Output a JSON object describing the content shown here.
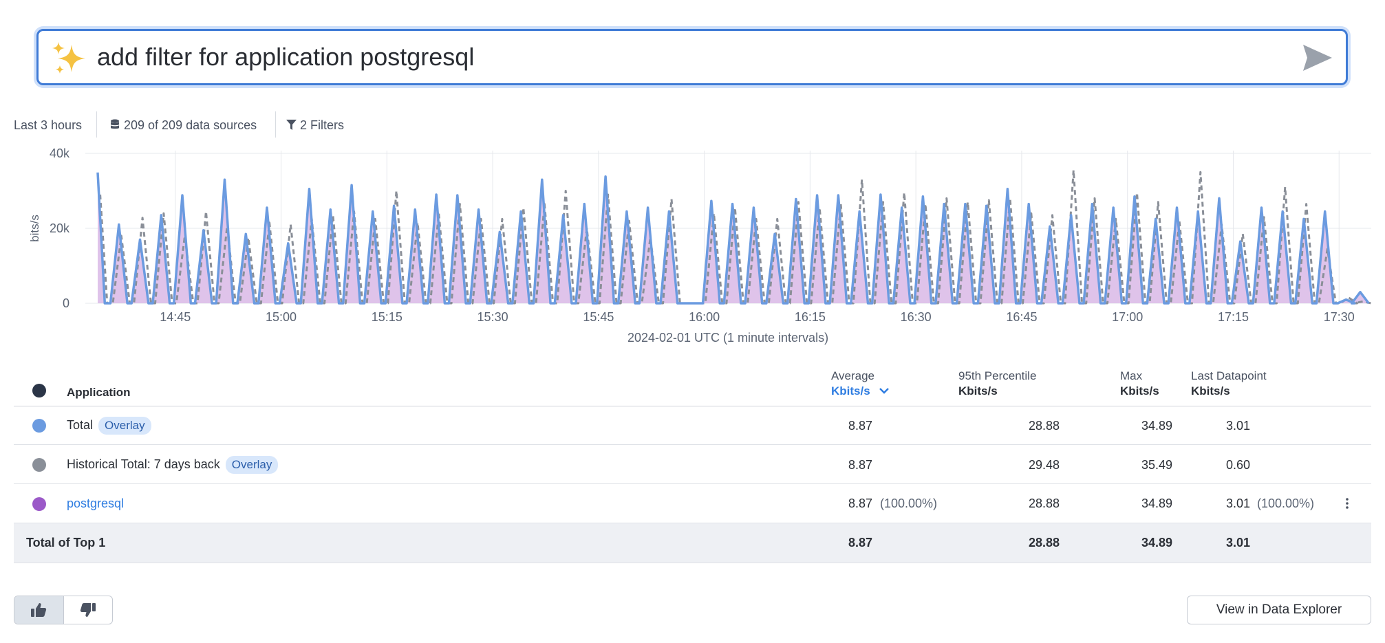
{
  "query": {
    "text": "add filter for application postgresql"
  },
  "toolbar": {
    "time_range": "Last 3 hours",
    "data_sources": "209 of 209 data sources",
    "filters": "2 Filters"
  },
  "chart_data": {
    "type": "area",
    "ylabel": "bits/s",
    "xlabel": "2024-02-01 UTC (1 minute intervals)",
    "y_ticks": [
      "0",
      "20k",
      "40k"
    ],
    "ylim": [
      0,
      40000
    ],
    "x_ticks": [
      "14:45",
      "15:00",
      "15:15",
      "15:30",
      "15:45",
      "16:00",
      "16:15",
      "16:30",
      "16:45",
      "17:00",
      "17:15",
      "17:30"
    ],
    "x_range": [
      "14:34",
      "17:33"
    ],
    "grid": true,
    "legend": "none",
    "series": [
      {
        "name": "Total",
        "style": "line",
        "color": "#6b9be0",
        "peaks": [
          {
            "t": "14:34",
            "v": 34900
          },
          {
            "t": "14:37",
            "v": 21000
          },
          {
            "t": "14:40",
            "v": 17000
          },
          {
            "t": "14:43",
            "v": 23500
          },
          {
            "t": "14:46",
            "v": 28800
          },
          {
            "t": "14:49",
            "v": 19500
          },
          {
            "t": "14:52",
            "v": 33000
          },
          {
            "t": "14:55",
            "v": 18500
          },
          {
            "t": "14:58",
            "v": 25500
          },
          {
            "t": "15:01",
            "v": 16000
          },
          {
            "t": "15:04",
            "v": 30500
          },
          {
            "t": "15:07",
            "v": 25000
          },
          {
            "t": "15:10",
            "v": 31500
          },
          {
            "t": "15:13",
            "v": 24500
          },
          {
            "t": "15:16",
            "v": 26000
          },
          {
            "t": "15:19",
            "v": 25000
          },
          {
            "t": "15:22",
            "v": 29000
          },
          {
            "t": "15:25",
            "v": 28800
          },
          {
            "t": "15:28",
            "v": 25000
          },
          {
            "t": "15:31",
            "v": 19000
          },
          {
            "t": "15:34",
            "v": 24500
          },
          {
            "t": "15:37",
            "v": 33000
          },
          {
            "t": "15:40",
            "v": 23500
          },
          {
            "t": "15:43",
            "v": 26500
          },
          {
            "t": "15:46",
            "v": 33800
          },
          {
            "t": "15:49",
            "v": 24500
          },
          {
            "t": "15:52",
            "v": 25500
          },
          {
            "t": "15:55",
            "v": 24500
          },
          {
            "t": "16:01",
            "v": 27300
          },
          {
            "t": "16:04",
            "v": 26500
          },
          {
            "t": "16:07",
            "v": 25500
          },
          {
            "t": "16:10",
            "v": 18500
          },
          {
            "t": "16:13",
            "v": 27800
          },
          {
            "t": "16:16",
            "v": 28800
          },
          {
            "t": "16:19",
            "v": 28800
          },
          {
            "t": "16:22",
            "v": 24500
          },
          {
            "t": "16:25",
            "v": 29000
          },
          {
            "t": "16:28",
            "v": 25500
          },
          {
            "t": "16:31",
            "v": 28500
          },
          {
            "t": "16:34",
            "v": 26500
          },
          {
            "t": "16:37",
            "v": 26500
          },
          {
            "t": "16:40",
            "v": 26000
          },
          {
            "t": "16:43",
            "v": 30500
          },
          {
            "t": "16:46",
            "v": 26500
          },
          {
            "t": "16:49",
            "v": 20500
          },
          {
            "t": "16:52",
            "v": 23500
          },
          {
            "t": "16:55",
            "v": 26500
          },
          {
            "t": "16:58",
            "v": 25500
          },
          {
            "t": "17:01",
            "v": 28500
          },
          {
            "t": "17:04",
            "v": 22500
          },
          {
            "t": "17:07",
            "v": 25500
          },
          {
            "t": "17:10",
            "v": 24500
          },
          {
            "t": "17:13",
            "v": 28000
          },
          {
            "t": "17:16",
            "v": 16500
          },
          {
            "t": "17:19",
            "v": 25500
          },
          {
            "t": "17:22",
            "v": 24500
          },
          {
            "t": "17:25",
            "v": 22500
          },
          {
            "t": "17:28",
            "v": 24500
          },
          {
            "t": "17:31",
            "v": 1000
          },
          {
            "t": "17:33",
            "v": 3000
          }
        ]
      },
      {
        "name": "Historical Total: 7 days back",
        "style": "dashed",
        "color": "#8a8f98",
        "peaks": [
          {
            "t": "14:34",
            "v": 29000
          },
          {
            "t": "14:37",
            "v": 18000
          },
          {
            "t": "14:40",
            "v": 22800
          },
          {
            "t": "14:43",
            "v": 24000
          },
          {
            "t": "14:46",
            "v": 18000
          },
          {
            "t": "14:49",
            "v": 24500
          },
          {
            "t": "14:52",
            "v": 20500
          },
          {
            "t": "14:55",
            "v": 17500
          },
          {
            "t": "14:58",
            "v": 21500
          },
          {
            "t": "15:01",
            "v": 21000
          },
          {
            "t": "15:04",
            "v": 22500
          },
          {
            "t": "15:07",
            "v": 23500
          },
          {
            "t": "15:10",
            "v": 24500
          },
          {
            "t": "15:13",
            "v": 22500
          },
          {
            "t": "15:16",
            "v": 30000
          },
          {
            "t": "15:19",
            "v": 21500
          },
          {
            "t": "15:22",
            "v": 24000
          },
          {
            "t": "15:25",
            "v": 26500
          },
          {
            "t": "15:28",
            "v": 22500
          },
          {
            "t": "15:31",
            "v": 22500
          },
          {
            "t": "15:34",
            "v": 25500
          },
          {
            "t": "15:37",
            "v": 26500
          },
          {
            "t": "15:40",
            "v": 30000
          },
          {
            "t": "15:43",
            "v": 20000
          },
          {
            "t": "15:46",
            "v": 29000
          },
          {
            "t": "15:49",
            "v": 22000
          },
          {
            "t": "15:52",
            "v": 17500
          },
          {
            "t": "15:55",
            "v": 27800
          },
          {
            "t": "16:01",
            "v": 24000
          },
          {
            "t": "16:04",
            "v": 25500
          },
          {
            "t": "16:07",
            "v": 22500
          },
          {
            "t": "16:10",
            "v": 22500
          },
          {
            "t": "16:13",
            "v": 27000
          },
          {
            "t": "16:16",
            "v": 25500
          },
          {
            "t": "16:19",
            "v": 26500
          },
          {
            "t": "16:22",
            "v": 33000
          },
          {
            "t": "16:25",
            "v": 27000
          },
          {
            "t": "16:28",
            "v": 29500
          },
          {
            "t": "16:31",
            "v": 26500
          },
          {
            "t": "16:34",
            "v": 28000
          },
          {
            "t": "16:37",
            "v": 27000
          },
          {
            "t": "16:40",
            "v": 27500
          },
          {
            "t": "16:43",
            "v": 28000
          },
          {
            "t": "16:46",
            "v": 24000
          },
          {
            "t": "16:49",
            "v": 23500
          },
          {
            "t": "16:52",
            "v": 35500
          },
          {
            "t": "16:55",
            "v": 28000
          },
          {
            "t": "16:58",
            "v": 22500
          },
          {
            "t": "17:01",
            "v": 29500
          },
          {
            "t": "17:04",
            "v": 27000
          },
          {
            "t": "17:07",
            "v": 22000
          },
          {
            "t": "17:10",
            "v": 35000
          },
          {
            "t": "17:13",
            "v": 21000
          },
          {
            "t": "17:16",
            "v": 18500
          },
          {
            "t": "17:19",
            "v": 23000
          },
          {
            "t": "17:22",
            "v": 31000
          },
          {
            "t": "17:25",
            "v": 26500
          },
          {
            "t": "17:28",
            "v": 14500
          },
          {
            "t": "17:31",
            "v": 1500
          },
          {
            "t": "17:33",
            "v": 500
          }
        ]
      },
      {
        "name": "postgresql",
        "style": "area",
        "color": "#d9b8e6"
      }
    ]
  },
  "table": {
    "headers": {
      "application": "Application",
      "average_top": "Average",
      "average_unit": "Kbits/s",
      "p95_top": "95th Percentile",
      "p95_unit": "Kbits/s",
      "max_top": "Max",
      "max_unit": "Kbits/s",
      "last_top": "Last Datapoint",
      "last_unit": "Kbits/s"
    },
    "colors": {
      "header_dot": "#2b3547",
      "total": "#6b9be0",
      "historical": "#8a8f98",
      "postgresql": "#9b59c8"
    },
    "rows": [
      {
        "name": "Total",
        "badge": "Overlay",
        "average": "8.87",
        "p95": "28.88",
        "max": "34.89",
        "last": "3.01"
      },
      {
        "name": "Historical Total: 7 days back",
        "badge": "Overlay",
        "average": "8.87",
        "p95": "29.48",
        "max": "35.49",
        "last": "0.60"
      },
      {
        "name": "postgresql",
        "average": "8.87",
        "average_pct": "(100.00%)",
        "p95": "28.88",
        "max": "34.89",
        "last": "3.01",
        "last_pct": "(100.00%)"
      }
    ],
    "total_row": {
      "name": "Total of Top 1",
      "average": "8.87",
      "p95": "28.88",
      "max": "34.89",
      "last": "3.01"
    }
  },
  "buttons": {
    "view_explorer": "View in Data Explorer"
  }
}
